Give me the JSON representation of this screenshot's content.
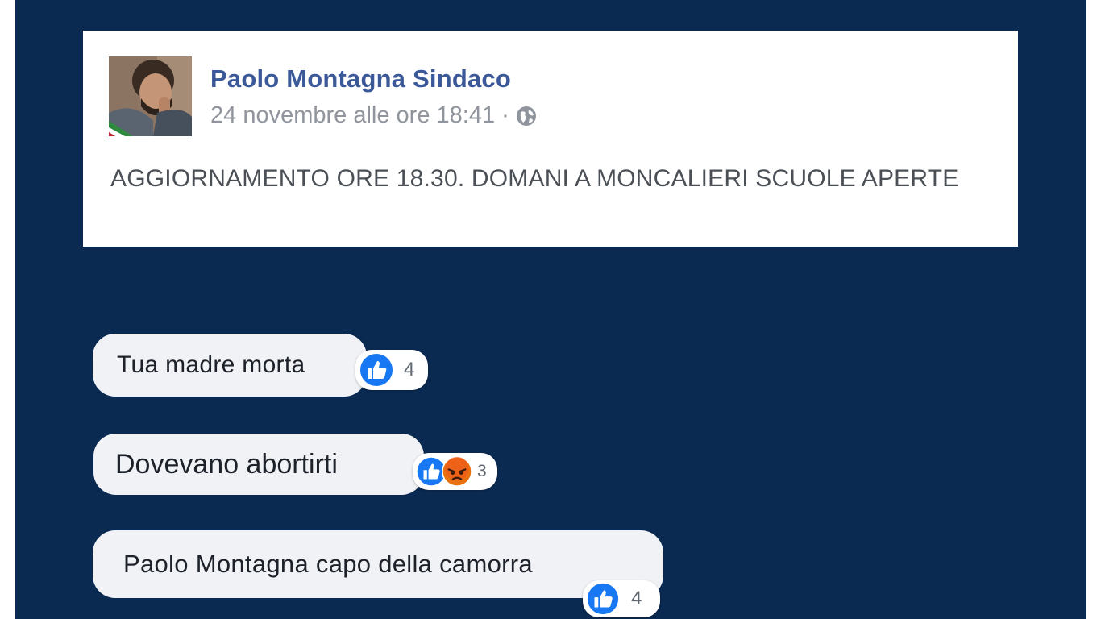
{
  "post": {
    "author": "Paolo Montagna Sindaco",
    "timestamp": "24 novembre alle ore 18:41",
    "separator": "·",
    "audience_icon": "globe-icon",
    "text": "AGGIORNAMENTO ORE 18.30. DOMANI A MONCALIERI SCUOLE APERTE"
  },
  "comments": [
    {
      "text": "Tua madre morta",
      "reactions": [
        "like-icon"
      ],
      "count": "4"
    },
    {
      "text": "Dovevano abortirti",
      "reactions": [
        "like-icon",
        "angry-icon"
      ],
      "count": "3"
    },
    {
      "text": "Paolo Montagna capo della camorra",
      "reactions": [
        "like-icon"
      ],
      "count": "4"
    }
  ],
  "colors": {
    "background": "#0b2a52",
    "author": "#3b5998",
    "like": "#1877f2",
    "angry": "#e9710f",
    "bubble": "#f1f2f5"
  }
}
